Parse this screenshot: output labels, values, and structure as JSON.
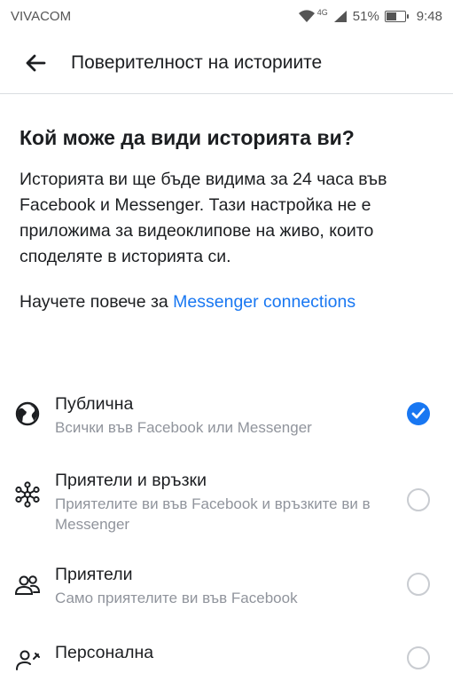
{
  "status": {
    "carrier": "VIVACOM",
    "network": "4G",
    "battery": "51%",
    "battery_level": 0.51,
    "time": "9:48"
  },
  "header": {
    "title": "Поверителност на историите"
  },
  "main": {
    "heading": "Кой може да види историята ви?",
    "description": "Историята ви ще бъде видима за 24 часа във Facebook и Messenger. Тази настройка не е приложима за видеоклипове на живо, които споделяте в историята си.",
    "learn_more_prefix": "Научете повече за ",
    "learn_more_link": "Messenger connections"
  },
  "options": [
    {
      "title": "Публична",
      "subtitle": "Всички във Facebook или Messenger",
      "icon": "globe-icon",
      "selected": true
    },
    {
      "title": "Приятели и връзки",
      "subtitle": "Приятелите ви във Facebook и връзките ви в Messenger",
      "icon": "network-icon",
      "selected": false
    },
    {
      "title": "Приятели",
      "subtitle": "Само приятелите ви във Facebook",
      "icon": "friends-icon",
      "selected": false
    },
    {
      "title": "Персонална",
      "subtitle": "",
      "icon": "custom-person-icon",
      "selected": false
    }
  ],
  "colors": {
    "accent": "#1877f2",
    "secondary_text": "#90949c"
  }
}
